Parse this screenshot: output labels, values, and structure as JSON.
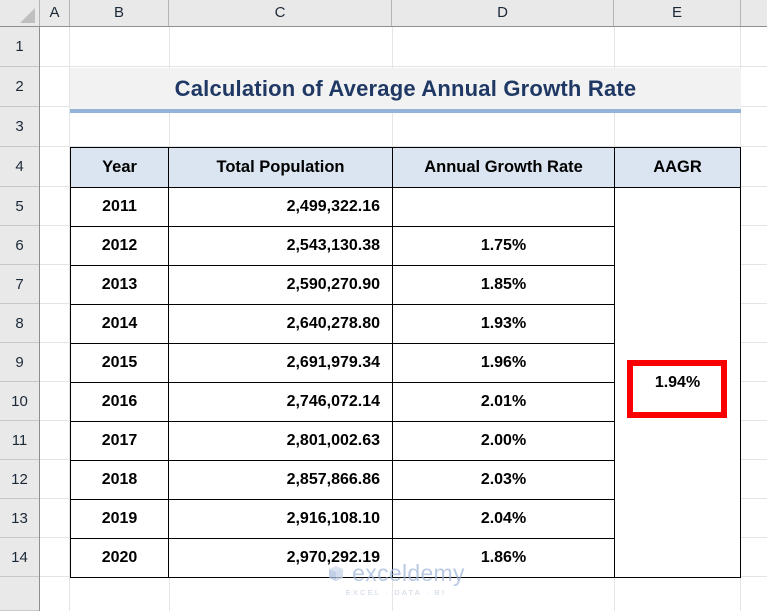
{
  "spreadsheet": {
    "column_headers": [
      "A",
      "B",
      "C",
      "D",
      "E"
    ],
    "row_headers": [
      "1",
      "2",
      "3",
      "4",
      "5",
      "6",
      "7",
      "8",
      "9",
      "10",
      "11",
      "12",
      "13",
      "14"
    ]
  },
  "title": {
    "text": "Calculation of Average Annual Growth Rate",
    "text_color": "#1F3864",
    "background": "#F2F2F2",
    "underline_color": "#95B3D7"
  },
  "table": {
    "header_background": "#DBE5F1",
    "headers": [
      "Year",
      "Total Population",
      "Annual Growth Rate",
      "AAGR"
    ],
    "rows": [
      {
        "year": "2011",
        "population": "2,499,322.16",
        "growth": ""
      },
      {
        "year": "2012",
        "population": "2,543,130.38",
        "growth": "1.75%"
      },
      {
        "year": "2013",
        "population": "2,590,270.90",
        "growth": "1.85%"
      },
      {
        "year": "2014",
        "population": "2,640,278.80",
        "growth": "1.93%"
      },
      {
        "year": "2015",
        "population": "2,691,979.34",
        "growth": "1.96%"
      },
      {
        "year": "2016",
        "population": "2,746,072.14",
        "growth": "2.01%"
      },
      {
        "year": "2017",
        "population": "2,801,002.63",
        "growth": "2.00%"
      },
      {
        "year": "2018",
        "population": "2,857,866.86",
        "growth": "2.03%"
      },
      {
        "year": "2019",
        "population": "2,916,108.10",
        "growth": "2.04%"
      },
      {
        "year": "2020",
        "population": "2,970,292.19",
        "growth": "1.86%"
      }
    ],
    "aagr_value": "1.94%",
    "aagr_highlight_color": "#FA0000"
  },
  "watermark": {
    "name": "exceldemy",
    "tagline": "EXCEL · DATA · BI",
    "color": "#9FB6D8"
  }
}
